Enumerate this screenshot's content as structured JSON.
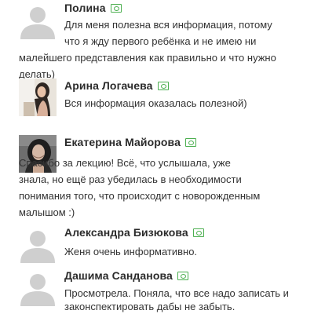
{
  "comments": [
    {
      "author": "Полина",
      "avatar": "default-avatar",
      "badge": "verified-money-icon",
      "lines": [
        "Для меня полезна вся информация, потому",
        "что я жду первого ребёнка и не имею ни",
        "малейшего представления как правильно и что нужно",
        "делать)"
      ]
    },
    {
      "author": "Арина Логачева",
      "avatar": "photo-avatar",
      "badge": "verified-money-icon",
      "lines": [
        "Вся информация оказалась полезной)"
      ]
    },
    {
      "author": "Екатерина Майорова",
      "avatar": "photo-avatar",
      "badge": "verified-money-icon",
      "lines": [
        "Спасибо за лекцию! Всё, что услышала, уже",
        "знала, но ещё раз убедилась в необходимости",
        "понимания того, что происходит с новорожденным",
        "малышом :)"
      ]
    },
    {
      "author": "Александра Бизюкова",
      "avatar": "default-avatar",
      "badge": "verified-money-icon",
      "lines": [
        "Женя очень информативно."
      ]
    },
    {
      "author": "Дашима Санданова",
      "avatar": "default-avatar",
      "badge": "verified-money-icon",
      "lines": [
        "Просмотрела. Поняла, что все надо записать и",
        "законспектировать дабы не забыть."
      ]
    }
  ],
  "colors": {
    "badge": "#4caf50",
    "placeholder_avatar": "#cfcfcf",
    "text": "#333333"
  }
}
